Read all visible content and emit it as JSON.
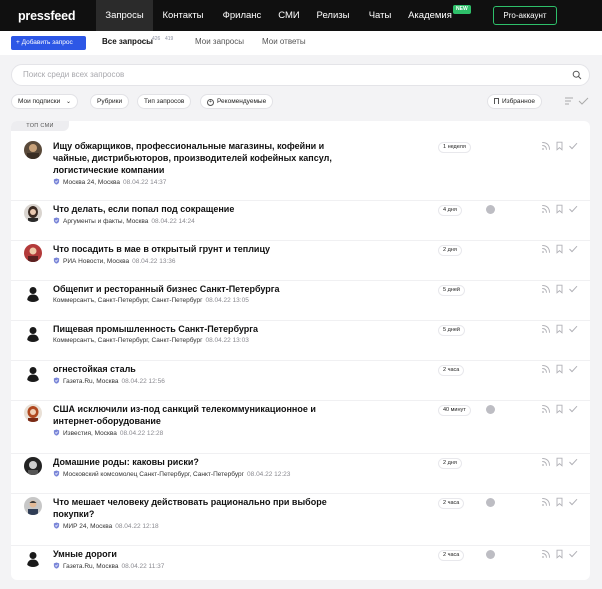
{
  "nav": {
    "logo": "pressfeed",
    "items": [
      "Запросы",
      "Контакты",
      "Фриланс",
      "СМИ",
      "Релизы",
      "Чаты",
      "Академия"
    ],
    "new_badge": "NEW",
    "pro_button": "Pro-аккаунт"
  },
  "subheader": {
    "add_button": "+ Добавить запрос",
    "tabs": [
      "Все запросы",
      "Мои запросы",
      "Мои ответы"
    ],
    "counts": [
      "426",
      "419"
    ]
  },
  "search": {
    "placeholder": "Поиск среди всех запросов"
  },
  "filters": {
    "my_subscriptions": "Мои подписки",
    "rubrics": "Рубрики",
    "request_types": "Тип запросов",
    "recommended": "Рекомендуемые",
    "favorites": "Избранное"
  },
  "section_label": "ТОП СМИ",
  "colors": {
    "accent": "#2d57e6",
    "green": "#2ec06a",
    "nav_bg": "#101010"
  },
  "rows": [
    {
      "title": "Ищу обжарщиков, профессиональные магазины, кофейни и чайные, дистрибьюторов, производителей кофейных капсул, логистические компании",
      "outlet": "Москва 24, Москва",
      "date": "08.04.22 14:37",
      "age": "1 неделя",
      "verified": true,
      "avatar": "photo-dark",
      "dot": false
    },
    {
      "title": "Что делать, если попал под сокращение",
      "outlet": "Аргументы и факты, Москва",
      "date": "08.04.22 14:24",
      "age": "4 дня",
      "verified": true,
      "avatar": "photo-woman",
      "dot": true
    },
    {
      "title": "Что посадить в мае в открытый грунт и теплицу",
      "outlet": "РИА Новости, Москва",
      "date": "08.04.22 13:36",
      "age": "2 дня",
      "verified": true,
      "avatar": "photo-red",
      "dot": false
    },
    {
      "title": "Общепит и ресторанный бизнес Санкт-Петербурга",
      "outlet": "Коммерсантъ, Санкт-Петербург, Санкт-Петербург",
      "date": "08.04.22 13:05",
      "age": "5 дней",
      "verified": false,
      "avatar": "silhouette",
      "dot": false
    },
    {
      "title": "Пищевая промышленность Санкт-Петербурга",
      "outlet": "Коммерсантъ, Санкт-Петербург, Санкт-Петербург",
      "date": "08.04.22 13:03",
      "age": "5 дней",
      "verified": false,
      "avatar": "silhouette",
      "dot": false
    },
    {
      "title": "огнестойкая сталь",
      "outlet": "Газета.Ru, Москва",
      "date": "08.04.22 12:56",
      "age": "2 часа",
      "verified": true,
      "avatar": "silhouette",
      "dot": false
    },
    {
      "title": "США исключили из-под санкций телекоммуникационное и интернет-оборудование",
      "outlet": "Известия, Москва",
      "date": "08.04.22 12:28",
      "age": "40 минут",
      "verified": true,
      "avatar": "photo-redhair",
      "dot": true
    },
    {
      "title": "Домашние роды: каковы риски?",
      "outlet": "Московский комсомолец Санкт-Петербург, Санкт-Петербург",
      "date": "08.04.22 12:23",
      "age": "2 дня",
      "verified": true,
      "avatar": "photo-bw",
      "dot": false
    },
    {
      "title": "Что мешает человеку действовать рационально при выборе покупки?",
      "outlet": "МИР 24, Москва",
      "date": "08.04.22 12:18",
      "age": "2 часа",
      "verified": true,
      "avatar": "photo-man",
      "dot": true
    },
    {
      "title": "Умные дороги",
      "outlet": "Газета.Ru, Москва",
      "date": "08.04.22 11:37",
      "age": "2 часа",
      "verified": true,
      "avatar": "silhouette",
      "dot": true
    }
  ]
}
